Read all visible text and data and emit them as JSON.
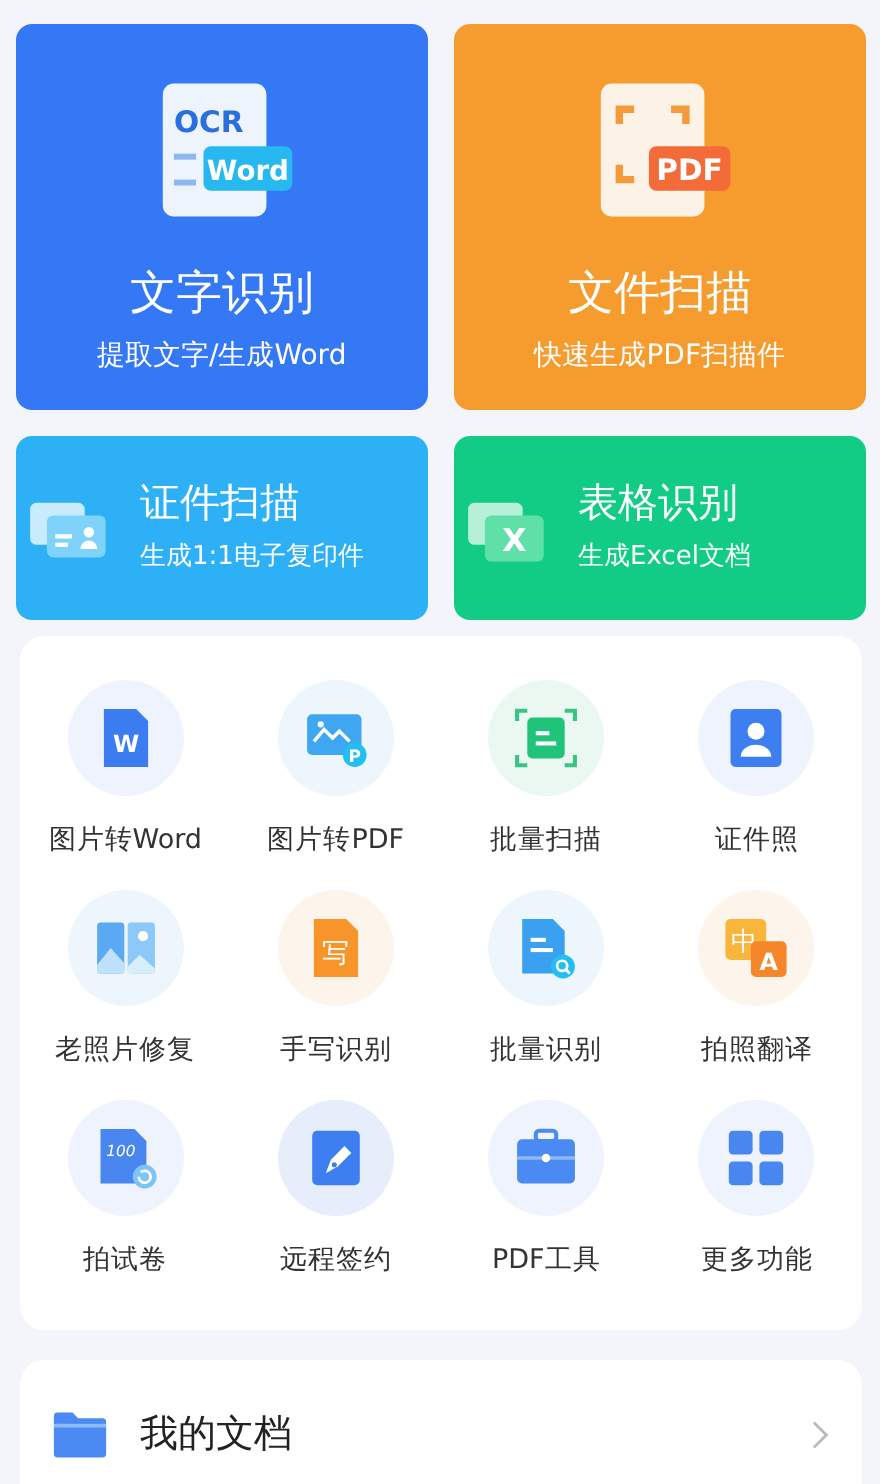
{
  "feature_cards": [
    {
      "kind": "ocr",
      "title": "文字识别",
      "subtitle": "提取文字/生成Word",
      "color": "#3478f6",
      "icon_texts": [
        "OCR",
        "Word"
      ]
    },
    {
      "kind": "pdf-scan",
      "title": "文件扫描",
      "subtitle": "快速生成PDF扫描件",
      "color": "#f69b2e",
      "icon_texts": [
        "PDF"
      ]
    }
  ],
  "quick_cards": [
    {
      "kind": "id-scan",
      "title": "证件扫描",
      "subtitle": "生成1:1电子复印件",
      "color": "#2db0f6"
    },
    {
      "kind": "excel",
      "title": "表格识别",
      "subtitle": "生成Excel文档",
      "color": "#12cc86",
      "icon_texts": [
        "X"
      ]
    }
  ],
  "tools": [
    {
      "kind": "word",
      "label": "图片转Word",
      "icon_texts": [
        "W"
      ]
    },
    {
      "kind": "image-pdf",
      "label": "图片转PDF",
      "icon_texts": [
        "P"
      ]
    },
    {
      "kind": "scan",
      "label": "批量扫描"
    },
    {
      "kind": "id-photo",
      "label": "证件照"
    },
    {
      "kind": "photo-restore",
      "label": "老照片修复"
    },
    {
      "kind": "handwrite",
      "label": "手写识别",
      "icon_texts": [
        "写"
      ]
    },
    {
      "kind": "batch",
      "label": "批量识别"
    },
    {
      "kind": "translate",
      "label": "拍照翻译",
      "icon_texts": [
        "中",
        "A"
      ]
    },
    {
      "kind": "exam",
      "label": "拍试卷",
      "icon_texts": [
        "100"
      ]
    },
    {
      "kind": "sign",
      "label": "远程签约"
    },
    {
      "kind": "toolbox",
      "label": "PDF工具"
    },
    {
      "kind": "grid",
      "label": "更多功能"
    }
  ],
  "my_documents": {
    "label": "我的文档"
  }
}
